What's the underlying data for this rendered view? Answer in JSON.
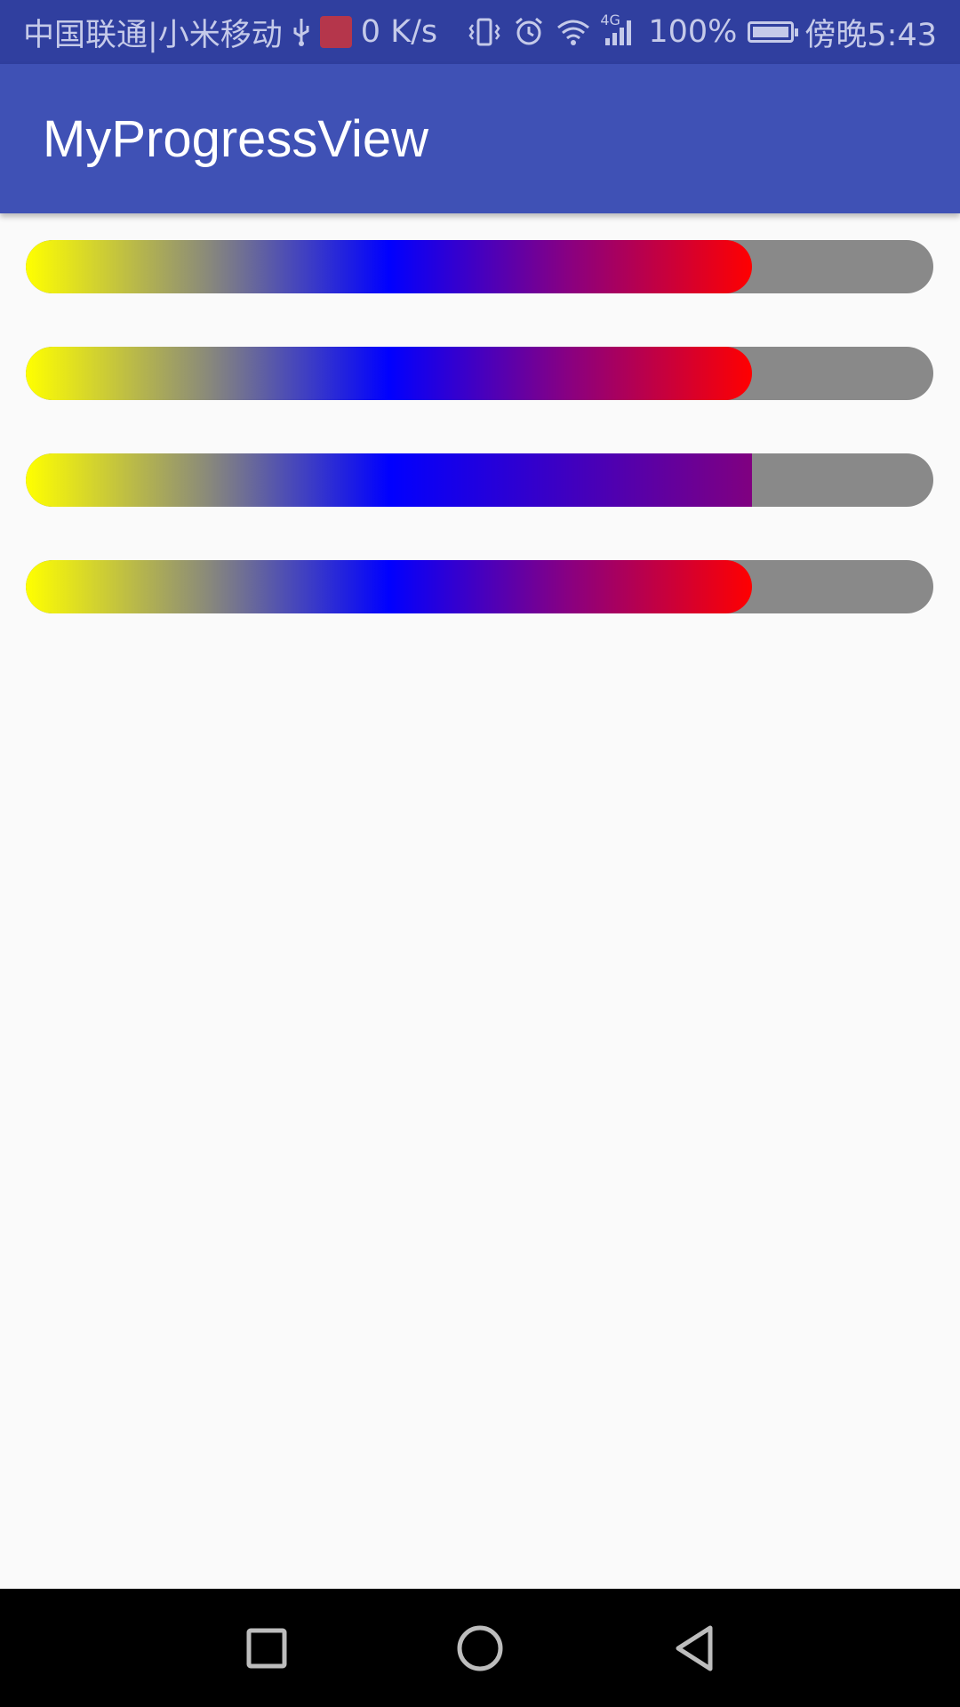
{
  "status_bar": {
    "carrier": "中国联通|小米移动",
    "net_speed": "0 K/s",
    "network_type": "4G",
    "battery": "100%",
    "time": "傍晚5:43",
    "icons": [
      "usb-icon",
      "app-notification-icon",
      "vibrate-icon",
      "alarm-icon",
      "wifi-icon",
      "signal-icon",
      "battery-charging-icon"
    ]
  },
  "app_bar": {
    "title": "MyProgressView"
  },
  "progress_bars": [
    {
      "progress": 0.8,
      "end_style": "rounded",
      "colors": [
        "#ffff00",
        "#0000ff",
        "#ff0000"
      ],
      "track_color": "#898989"
    },
    {
      "progress": 0.8,
      "end_style": "rounded",
      "colors": [
        "#ffff00",
        "#0000ff",
        "#ff0000"
      ],
      "track_color": "#898989"
    },
    {
      "progress": 0.8,
      "end_style": "square",
      "colors": [
        "#ffff00",
        "#0000ff",
        "#800080"
      ],
      "track_color": "#898989"
    },
    {
      "progress": 0.8,
      "end_style": "rounded",
      "colors": [
        "#ffff00",
        "#0000ff",
        "#ff0000"
      ],
      "track_color": "#898989"
    }
  ],
  "nav_bar": {
    "buttons": [
      "recents-icon",
      "home-icon",
      "back-icon"
    ]
  }
}
